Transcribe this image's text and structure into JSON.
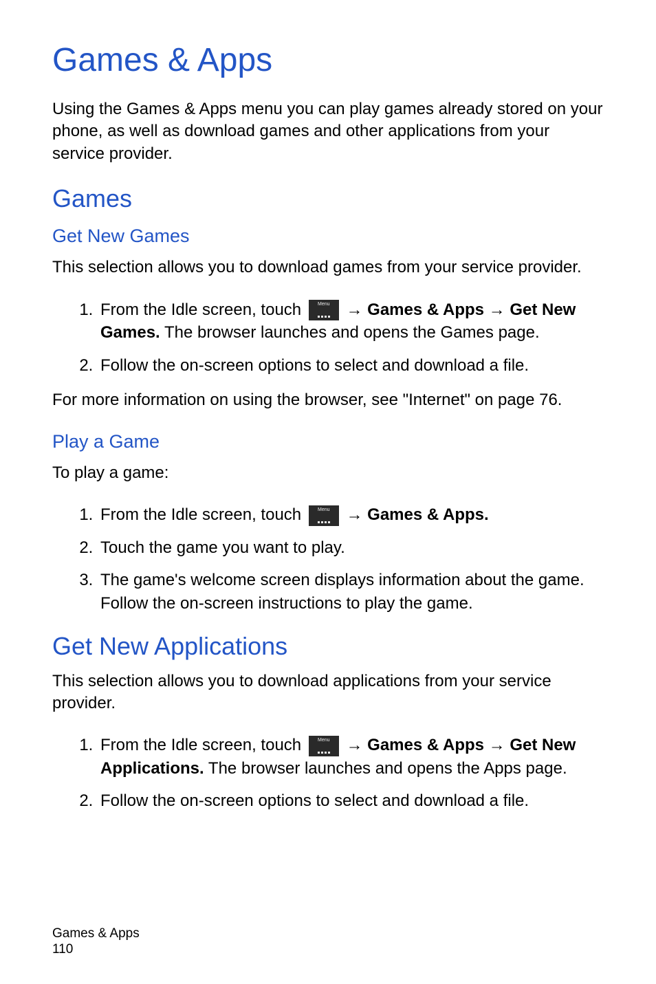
{
  "title": "Games & Apps",
  "intro": "Using the Games & Apps menu you can play games already stored on your phone, as well as download games and other applications from your service provider.",
  "section_games": {
    "heading": "Games",
    "get_new_games": {
      "heading": "Get New Games",
      "intro": "This selection allows you to download games from your service provider.",
      "steps": {
        "s1_pre": "From the Idle screen, touch ",
        "s1_arrow1": " → ",
        "s1_b1": "Games & Apps",
        "s1_arrow2": " → ",
        "s1_b2": "Get New Games.",
        "s1_post": " The browser launches and opens the Games page.",
        "s2": "Follow the on-screen options to select and download a file."
      },
      "more_info": "For more information on using the browser, see \"Internet\" on page 76."
    },
    "play_a_game": {
      "heading": "Play a Game",
      "intro": "To play a game:",
      "steps": {
        "s1_pre": "From the Idle screen, touch ",
        "s1_arrow": " → ",
        "s1_b": "Games & Apps.",
        "s2": "Touch the game you want to play.",
        "s3": "The game's welcome screen displays information about the game. Follow the on-screen instructions to play the game."
      }
    }
  },
  "section_get_new_apps": {
    "heading": "Get New Applications",
    "intro": "This selection allows you to download applications from your service provider.",
    "steps": {
      "s1_pre": "From the Idle screen, touch ",
      "s1_arrow1": " → ",
      "s1_b1": "Games & Apps",
      "s1_arrow2": " → ",
      "s1_b2": "Get New Applications.",
      "s1_post": " The browser launches and opens the Apps page.",
      "s2": "Follow the on-screen options to select and download a file."
    }
  },
  "footer": {
    "section": "Games & Apps",
    "page_number": "110"
  },
  "icon_label": "Menu"
}
